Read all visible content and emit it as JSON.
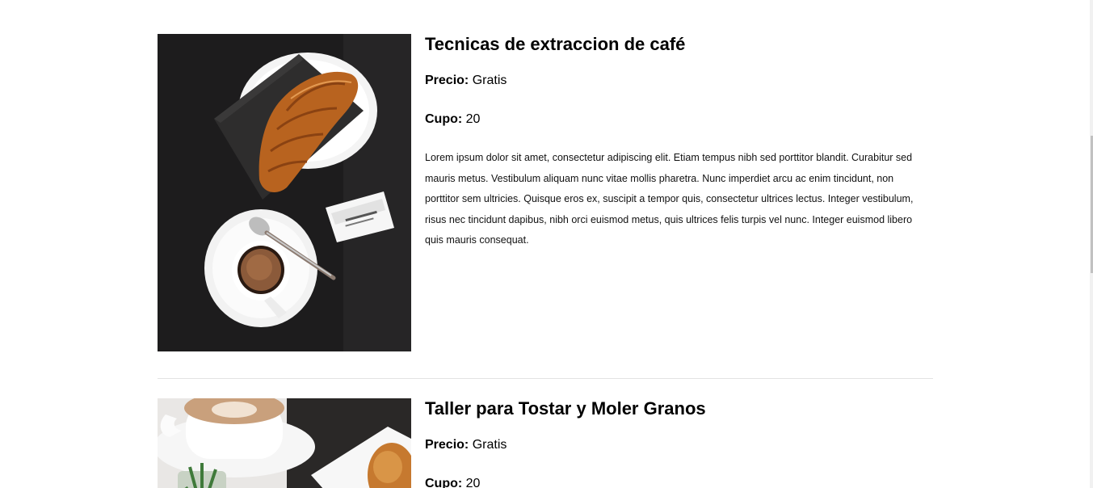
{
  "courses": [
    {
      "title": "Tecnicas de extraccion de café",
      "price_label": "Precio:",
      "price_value": " Gratis",
      "cupo_label": "Cupo:",
      "cupo_value": " 20",
      "description": "Lorem ipsum dolor sit amet, consectetur adipiscing elit. Etiam tempus nibh sed porttitor blandit. Curabitur sed mauris metus. Vestibulum aliquam nunc vitae mollis pharetra. Nunc imperdiet arcu ac enim tincidunt, non porttitor sem ultricies. Quisque eros ex, suscipit a tempor quis, consectetur ultrices lectus. Integer vestibulum, risus nec tincidunt dapibus, nibh orci euismod metus, quis ultrices felis turpis vel nunc. Integer euismod libero quis mauris consequat."
    },
    {
      "title": "Taller para Tostar y Moler Granos",
      "price_label": "Precio:",
      "price_value": " Gratis",
      "cupo_label": "Cupo:",
      "cupo_value": " 20"
    }
  ]
}
